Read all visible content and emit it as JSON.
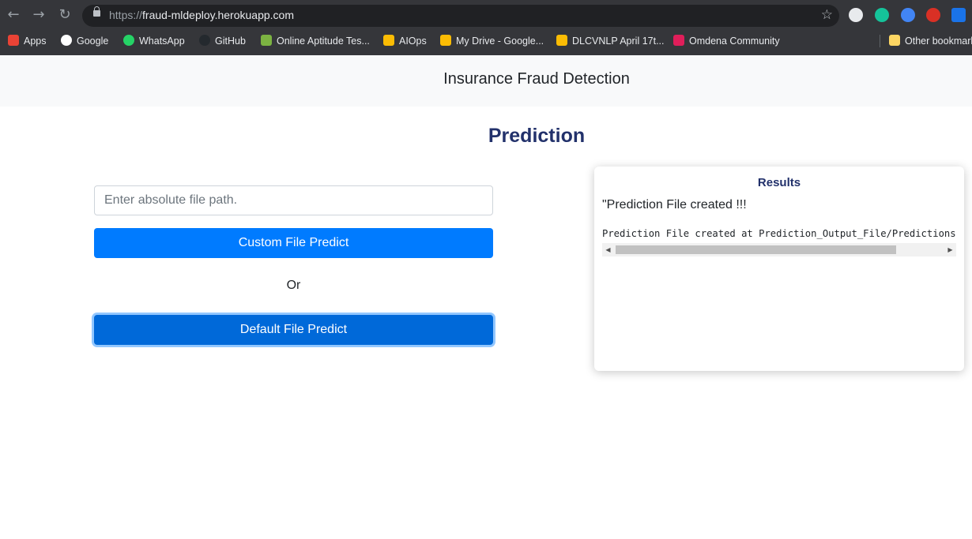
{
  "browser": {
    "url_scheme": "https://",
    "url_host": "fraud-mldeploy.herokuapp.com",
    "bookmarks": [
      {
        "label": "Apps",
        "icon": "apps-grid-icon",
        "color": "#ea4335"
      },
      {
        "label": "Google",
        "icon": "google-icon",
        "color": "#ffffff"
      },
      {
        "label": "WhatsApp",
        "icon": "whatsapp-icon",
        "color": "#25d366"
      },
      {
        "label": "GitHub",
        "icon": "github-icon",
        "color": "#24292e"
      },
      {
        "label": "Online Aptitude Tes...",
        "icon": "leaf-icon",
        "color": "#7cb342"
      },
      {
        "label": "AIOps",
        "icon": "google-drive-icon",
        "color": "#fbbc04"
      },
      {
        "label": "My Drive - Google...",
        "icon": "google-drive-icon",
        "color": "#fbbc04"
      },
      {
        "label": "DLCVNLP April 17t...",
        "icon": "google-drive-icon",
        "color": "#fbbc04"
      },
      {
        "label": "Omdena Community",
        "icon": "slack-icon",
        "color": "#e01e5a"
      },
      {
        "label": "Other bookmarks",
        "icon": "folder-icon",
        "color": "#fdd663"
      }
    ]
  },
  "navbar": {
    "title": "Insurance Fraud Detection"
  },
  "main": {
    "heading": "Prediction",
    "path_placeholder": "Enter absolute file path.",
    "custom_button": "Custom File Predict",
    "or_text": "Or",
    "default_button": "Default File Predict"
  },
  "results": {
    "title": "Results",
    "message": "\"Prediction File created !!!",
    "output": "Prediction File created at Prediction_Output_File/Predictions.csv!!!"
  },
  "colors": {
    "accent": "#007bff",
    "heading": "#22316b"
  }
}
